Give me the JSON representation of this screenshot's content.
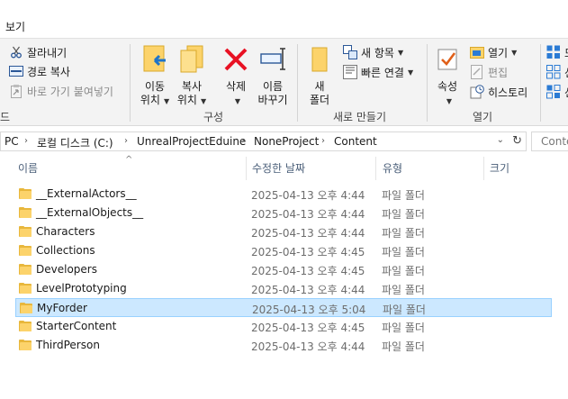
{
  "tabs": {
    "view": "보기"
  },
  "ribbon": {
    "clipboard": {
      "cut": "잘라내기",
      "copy_path": "경로 복사",
      "paste_shortcut": "바로 가기 붙여넣기",
      "group_label_partial": "드"
    },
    "organize": {
      "move_to_line1": "이동",
      "move_to_line2": "위치",
      "copy_to_line1": "복사",
      "copy_to_line2": "위치",
      "delete": "삭제",
      "rename_line1": "이름",
      "rename_line2": "바꾸기",
      "group_label": "구성"
    },
    "new": {
      "new_folder_line1": "새",
      "new_folder_line2": "폴더",
      "new_item": "새 항목",
      "easy_access": "빠른 연결",
      "group_label": "새로 만들기"
    },
    "open": {
      "properties": "속성",
      "open": "열기",
      "edit": "편집",
      "history": "히스토리",
      "group_label": "열기"
    },
    "select_partial": {
      "a": "모",
      "b": "선",
      "c": "선"
    }
  },
  "address": {
    "crumbs": [
      "PC",
      "로컬 디스크 (C:)",
      "UnrealProjectEduine",
      "NoneProject",
      "Content"
    ]
  },
  "search": {
    "placeholder": "Conte"
  },
  "columns": {
    "name": "이름",
    "date": "수정한 날짜",
    "type": "유형",
    "size": "크기"
  },
  "files": [
    {
      "name": "__ExternalActors__",
      "date": "2025-04-13 오후 4:44",
      "type": "파일 폴더"
    },
    {
      "name": "__ExternalObjects__",
      "date": "2025-04-13 오후 4:44",
      "type": "파일 폴더"
    },
    {
      "name": "Characters",
      "date": "2025-04-13 오후 4:44",
      "type": "파일 폴더"
    },
    {
      "name": "Collections",
      "date": "2025-04-13 오후 4:45",
      "type": "파일 폴더"
    },
    {
      "name": "Developers",
      "date": "2025-04-13 오후 4:45",
      "type": "파일 폴더"
    },
    {
      "name": "LevelPrototyping",
      "date": "2025-04-13 오후 4:44",
      "type": "파일 폴더"
    },
    {
      "name": "MyForder",
      "date": "2025-04-13 오후 5:04",
      "type": "파일 폴더"
    },
    {
      "name": "StarterContent",
      "date": "2025-04-13 오후 4:45",
      "type": "파일 폴더"
    },
    {
      "name": "ThirdPerson",
      "date": "2025-04-13 오후 4:44",
      "type": "파일 폴더"
    }
  ],
  "selected_index": 6,
  "colors": {
    "folder": "#fcd36b",
    "selection": "#cce8ff",
    "delete_red": "#e81123",
    "header_text": "#4c607a"
  }
}
